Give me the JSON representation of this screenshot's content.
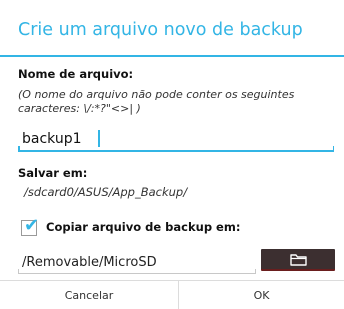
{
  "dialog": {
    "title": "Crie um arquivo novo de backup",
    "filename_label": "Nome de arquivo:",
    "filename_hint": "(O nome do arquivo não pode conter os seguintes caracteres: \\/:*?\"<>| )",
    "filename_value": "backup1",
    "save_label": "Salvar em:",
    "save_path": "/sdcard0/ASUS/App_Backup/",
    "copy_checkbox_label": "Copiar arquivo de backup em:",
    "copy_checked": true,
    "copy_destination": "/Removable/MicroSD",
    "browse_icon": "folder-icon",
    "cancel_label": "Cancelar",
    "ok_label": "OK"
  },
  "colors": {
    "accent": "#33b5e5",
    "browse_button": "#3c2f30"
  }
}
